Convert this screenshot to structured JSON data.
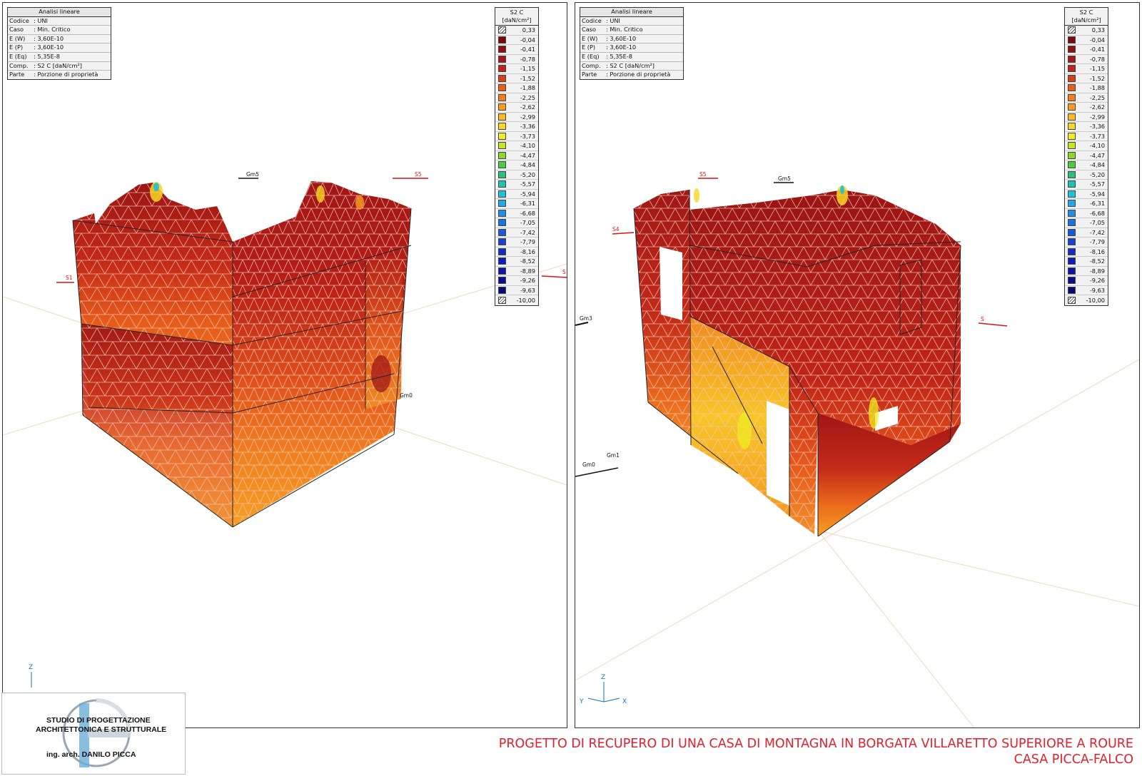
{
  "info_box": {
    "title": "Analisi lineare",
    "rows": [
      {
        "k": "Codice",
        "v": ": UNI"
      },
      {
        "k": "Caso",
        "v": ": Min. Critico"
      },
      {
        "k": "E (W)",
        "v": ": 3,60E-10"
      },
      {
        "k": "E (P)",
        "v": ": 3,60E-10"
      },
      {
        "k": "E (Eq)",
        "v": ": 5,35E-8"
      },
      {
        "k": "Comp.",
        "v": ": S2 C [daN/cm²]"
      },
      {
        "k": "Parte",
        "v": ": Porzione di proprietà"
      }
    ]
  },
  "legend": {
    "title": "S2 C",
    "unit": "[daN/cm²]",
    "entries": [
      {
        "value": "0,33",
        "color": "hatch"
      },
      {
        "value": "-0,04",
        "color": "#7a0a0a"
      },
      {
        "value": "-0,41",
        "color": "#8e1010"
      },
      {
        "value": "-0,78",
        "color": "#a61616"
      },
      {
        "value": "-1,15",
        "color": "#c02418"
      },
      {
        "value": "-1,52",
        "color": "#d8401a"
      },
      {
        "value": "-1,88",
        "color": "#ea5e1a"
      },
      {
        "value": "-2,25",
        "color": "#f47e1a"
      },
      {
        "value": "-2,62",
        "color": "#f99c1e"
      },
      {
        "value": "-2,99",
        "color": "#fbbb22"
      },
      {
        "value": "-3,36",
        "color": "#f8d624"
      },
      {
        "value": "-3,73",
        "color": "#eeee22"
      },
      {
        "value": "-4,10",
        "color": "#c6e620"
      },
      {
        "value": "-4,47",
        "color": "#8cd82a"
      },
      {
        "value": "-4,84",
        "color": "#4ccd3a"
      },
      {
        "value": "-5,20",
        "color": "#26c47a"
      },
      {
        "value": "-5,57",
        "color": "#1ec2b0"
      },
      {
        "value": "-5,94",
        "color": "#1ec0da"
      },
      {
        "value": "-6,31",
        "color": "#1eaaea"
      },
      {
        "value": "-6,68",
        "color": "#1c8ee8"
      },
      {
        "value": "-7,05",
        "color": "#1a72e2"
      },
      {
        "value": "-7,42",
        "color": "#1858dc"
      },
      {
        "value": "-7,79",
        "color": "#1640d6"
      },
      {
        "value": "-8,16",
        "color": "#122ccc"
      },
      {
        "value": "-8,52",
        "color": "#0e1cbc"
      },
      {
        "value": "-8,89",
        "color": "#0c14a6"
      },
      {
        "value": "-9,26",
        "color": "#0a0e8e"
      },
      {
        "value": "-9,63",
        "color": "#080a74"
      },
      {
        "value": "-10,00",
        "color": "hatch"
      }
    ]
  },
  "left_view": {
    "section_marks": [
      "S1",
      "S5",
      "S"
    ],
    "member_marks": [
      "Gm5",
      "Gm0"
    ],
    "axis": {
      "z": "Z"
    }
  },
  "right_view": {
    "section_marks": [
      "S5",
      "S4",
      "S"
    ],
    "member_marks": [
      "Gm5",
      "Gm3",
      "Gm0",
      "Gm1"
    ],
    "axis": {
      "z": "Z",
      "y": "Y",
      "x": "X"
    }
  },
  "logo": {
    "line1": "STUDIO DI PROGETTAZIONE",
    "line2": "ARCHITETTONICA E STRUTTURALE",
    "line3": "ing. arch. DANILO PICCA"
  },
  "caption": {
    "line1": "PROGETTO DI RECUPERO DI UNA CASA DI MONTAGNA IN BORGATA VILLARETTO SUPERIORE A ROURE",
    "line2": "CASA PICCA-FALCO"
  }
}
